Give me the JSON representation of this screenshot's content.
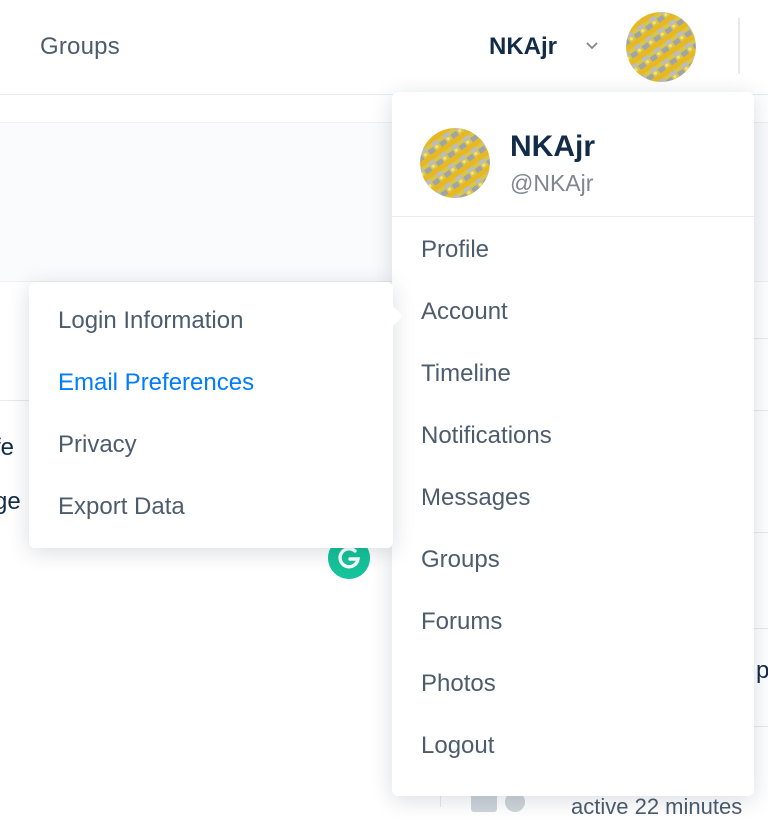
{
  "nav": {
    "groups_label": "Groups",
    "user_name": "NKAjr"
  },
  "user_menu": {
    "name": "NKAjr",
    "handle": "@NKAjr",
    "items": [
      {
        "label": "Profile"
      },
      {
        "label": "Account"
      },
      {
        "label": "Timeline"
      },
      {
        "label": "Notifications"
      },
      {
        "label": "Messages"
      },
      {
        "label": "Groups"
      },
      {
        "label": "Forums"
      },
      {
        "label": "Photos"
      },
      {
        "label": "Logout"
      }
    ]
  },
  "account_submenu": {
    "items": [
      {
        "label": "Login Information"
      },
      {
        "label": "Email Preferences",
        "active": true
      },
      {
        "label": "Privacy"
      },
      {
        "label": "Export Data"
      }
    ]
  },
  "background": {
    "fragment_1": "fe",
    "fragment_2": "ge",
    "fragment_3": "p",
    "activity_text": "active 22 minutes"
  },
  "colors": {
    "accent": "#007cff",
    "text_primary": "#122b46",
    "text_secondary": "#4d5c6d",
    "grammarly": "#15c39a"
  },
  "icons": {
    "dropdown": "chevron-down-icon",
    "grammarly": "grammarly-icon",
    "avatar": "avatar-pattern"
  }
}
